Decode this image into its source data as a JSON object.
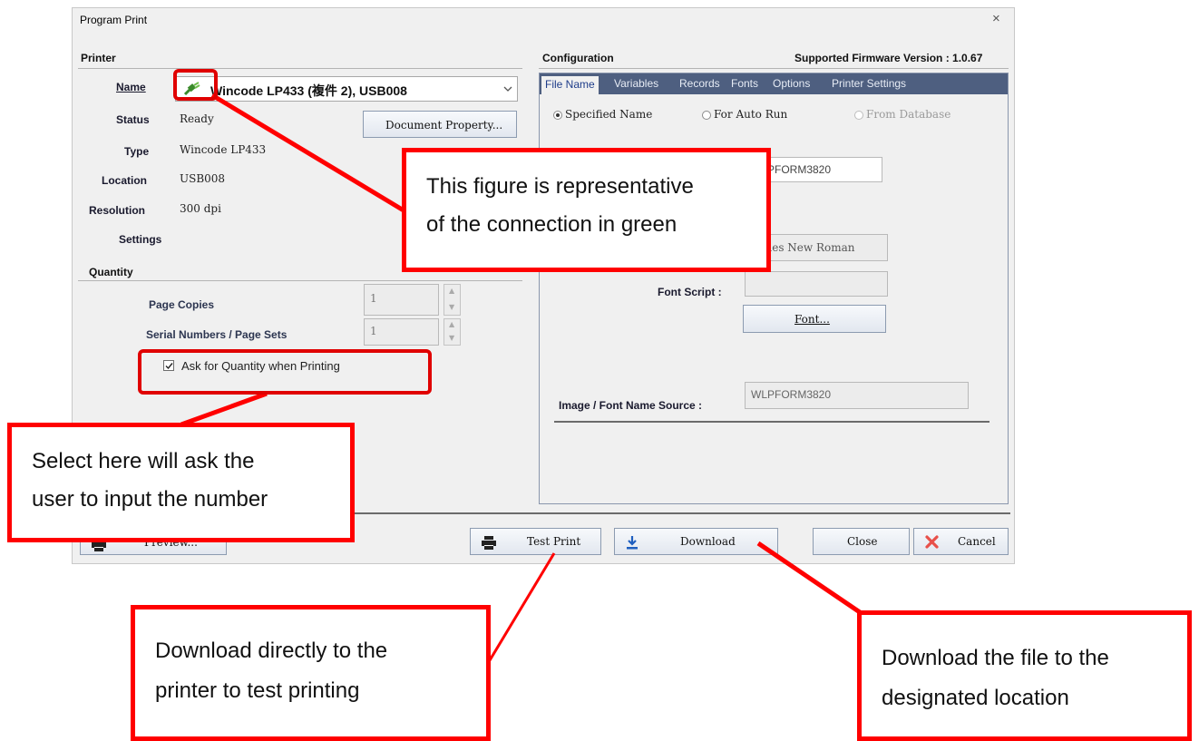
{
  "window": {
    "title": "Program Print",
    "close_glyph": "×"
  },
  "printer": {
    "section_title": "Printer",
    "name_label": "Name",
    "name_value": "Wincode LP433 (複件 2),  USB008",
    "status_label": "Status",
    "status_value": "Ready",
    "type_label": "Type",
    "type_value": "Wincode LP433",
    "location_label": "Location",
    "location_value": "USB008",
    "resolution_label": "Resolution",
    "resolution_value": "300 dpi",
    "settings_label": "Settings",
    "document_property_button": "Document Property...",
    "connection_icon": "green-connection-plug-icon",
    "connection_color": "#3a8a2a"
  },
  "quantity": {
    "section_title": "Quantity",
    "page_copies_label": "Page Copies",
    "page_copies_value": "1",
    "serial_label": "Serial Numbers / Page Sets",
    "serial_value": "1",
    "ask_checkbox_label": "Ask for Quantity when Printing",
    "ask_checked": true
  },
  "configuration": {
    "section_title": "Configuration",
    "firmware": "Supported Firmware Version : 1.0.67",
    "tabs": [
      "File Name",
      "Variables",
      "Records",
      "Fonts",
      "Options",
      "Printer Settings"
    ],
    "radio_specified": "Specified Name",
    "radio_autorun": "For Auto Run",
    "radio_database": "From Database",
    "filename_field": "WLPFORM3820",
    "font_name_field": "Times New Roman",
    "font_script_label": "Font Script :",
    "font_button": "Font...",
    "image_font_label": "Image / Font Name Source :",
    "image_font_value": "WLPFORM3820"
  },
  "buttons": {
    "preview": "Preview...",
    "test_print": "Test Print",
    "download": "Download",
    "close": "Close",
    "cancel": "Cancel"
  },
  "annotations": {
    "connection_note_line1": "This figure is representative",
    "connection_note_line2": "of the connection in green",
    "quantity_note_line1": "Select here will ask the",
    "quantity_note_line2": "user to input the number",
    "test_print_note_line1": "Download directly to the",
    "test_print_note_line2": "printer to test printing",
    "download_note_line1": "Download the file to the",
    "download_note_line2": "designated location",
    "highlight_color": "#ff0000"
  }
}
